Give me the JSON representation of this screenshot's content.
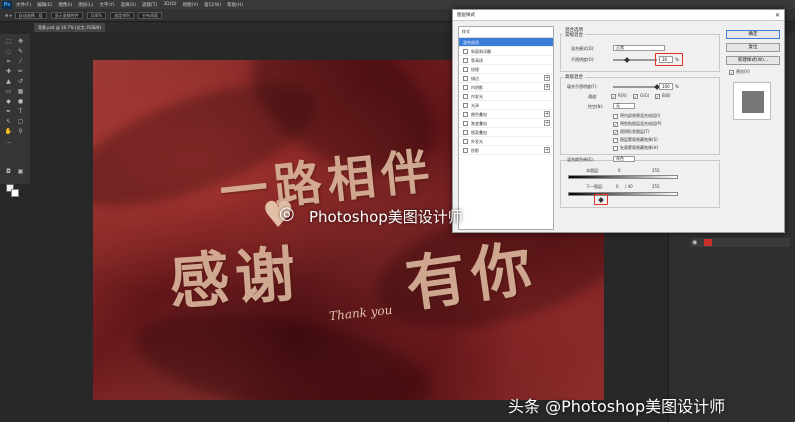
{
  "menubar": {
    "logo": "Ps",
    "items": [
      "文件(F)",
      "编辑(E)",
      "图像(I)",
      "图层(L)",
      "文字(Y)",
      "选择(S)",
      "滤镜(T)",
      "3D(D)",
      "视图(V)",
      "窗口(W)",
      "帮助(H)"
    ]
  },
  "options": {
    "field1": "自动选择：组",
    "field2": "显示变换控件",
    "field3": "100%",
    "field4": "选定排列",
    "field5": "分布间距"
  },
  "document": {
    "tab": "背景.psd @ 16.7% (文字, RGB/8)"
  },
  "artwork": {
    "line1": "一路相伴",
    "line2": "感谢",
    "line3": "有你",
    "thankyou": "Thank you",
    "heart": "♥"
  },
  "dialog": {
    "title": "图层样式",
    "close": "✕",
    "styles_header": "样式",
    "styles": [
      {
        "label": "混合选项",
        "selected": true,
        "checkbox": false,
        "plus": false
      },
      {
        "label": "斜面和浮雕",
        "selected": false,
        "checkbox": true,
        "plus": false
      },
      {
        "label": "等高线",
        "selected": false,
        "checkbox": true,
        "plus": false
      },
      {
        "label": "纹理",
        "selected": false,
        "checkbox": true,
        "plus": false
      },
      {
        "label": "描边",
        "selected": false,
        "checkbox": true,
        "plus": true
      },
      {
        "label": "内阴影",
        "selected": false,
        "checkbox": true,
        "plus": true
      },
      {
        "label": "内发光",
        "selected": false,
        "checkbox": true,
        "plus": false
      },
      {
        "label": "光泽",
        "selected": false,
        "checkbox": true,
        "plus": false
      },
      {
        "label": "颜色叠加",
        "selected": false,
        "checkbox": true,
        "plus": true
      },
      {
        "label": "渐变叠加",
        "selected": false,
        "checkbox": true,
        "plus": true
      },
      {
        "label": "图案叠加",
        "selected": false,
        "checkbox": true,
        "plus": false
      },
      {
        "label": "外发光",
        "selected": false,
        "checkbox": true,
        "plus": false
      },
      {
        "label": "投影",
        "selected": false,
        "checkbox": true,
        "plus": true
      }
    ],
    "general_section": "常规混合",
    "blend_section_title": "混合选项",
    "blend_mode_label": "混合模式(D):",
    "blend_mode_value": "正常",
    "opacity_label": "不透明度(O):",
    "opacity_value": "30",
    "opacity_unit": "%",
    "advanced_section": "高级混合",
    "fill_opacity_label": "填充不透明度(F):",
    "fill_opacity_value": "100",
    "fill_opacity_unit": "%",
    "channels_label": "通道:",
    "channel_r": "R(R)",
    "channel_g": "G(G)",
    "channel_b": "B(B)",
    "knockout_label": "挖空(N):",
    "knockout_value": "无",
    "checkboxes": [
      {
        "label": "将内部效果混合成组(I)",
        "checked": false
      },
      {
        "label": "将剪贴图层混合成组(P)",
        "checked": true
      },
      {
        "label": "透明形状图层(T)",
        "checked": true
      },
      {
        "label": "图层蒙版隐藏效果(S)",
        "checked": false
      },
      {
        "label": "矢量蒙版隐藏效果(H)",
        "checked": false
      }
    ],
    "blend_if_label": "混合颜色带(E):",
    "blend_if_value": "灰色",
    "this_layer_label": "本图层:",
    "this_layer_min": "0",
    "this_layer_max": "255",
    "under_layer_label": "下一图层:",
    "under_layer_min": "0",
    "under_layer_split": "/ 40",
    "under_layer_max": "255",
    "btn_ok": "确定",
    "btn_reset": "复位",
    "btn_new_style": "新建样式(W)...",
    "preview_label": "预览(V)"
  },
  "watermark": {
    "center": "Photoshop美图设计师",
    "bottom": "头条 @Photoshop美图设计师"
  }
}
